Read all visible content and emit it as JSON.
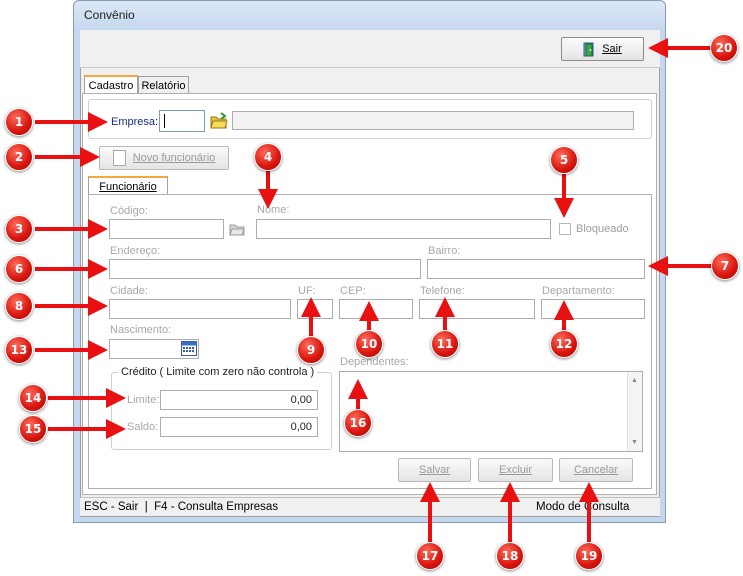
{
  "window": {
    "title": "Convênio"
  },
  "toolbar": {
    "exit_label": "Sair"
  },
  "tabs": [
    {
      "label": "Cadastro"
    },
    {
      "label": "Relatório"
    }
  ],
  "empresa": {
    "label": "Empresa:",
    "code_value": "",
    "name_value": ""
  },
  "new_employee_label": "Novo funcionário",
  "subtab": {
    "label": "Funcionário"
  },
  "form": {
    "codigo": "Código:",
    "nome": "Nome:",
    "bloqueado": "Bloqueado",
    "endereco": "Endereço:",
    "bairro": "Bairro:",
    "cidade": "Cidade:",
    "uf": "UF:",
    "cep": "CEP:",
    "telefone": "Telefone:",
    "departamento": "Departamento:",
    "nascimento": "Nascimento:",
    "dependentes": "Dependentes:"
  },
  "credit": {
    "title": "Crédito ( Limite com zero não controla )",
    "limit_label": "Limite:",
    "limit_value": "0,00",
    "balance_label": "Saldo:",
    "balance_value": "0,00"
  },
  "actions": {
    "save": "Salvar",
    "delete": "Excluir",
    "cancel": "Cancelar"
  },
  "status": {
    "left": "ESC - Sair  |  F4 - Consulta Empresas",
    "right": "Modo de Consulta"
  },
  "markers": [
    "1",
    "2",
    "3",
    "4",
    "5",
    "6",
    "7",
    "8",
    "9",
    "10",
    "11",
    "12",
    "13",
    "14",
    "15",
    "16",
    "17",
    "18",
    "19",
    "20"
  ],
  "colors": {
    "marker": "#d7140d",
    "arrow": "#e81010",
    "tab_accent": "#f7a73b"
  }
}
